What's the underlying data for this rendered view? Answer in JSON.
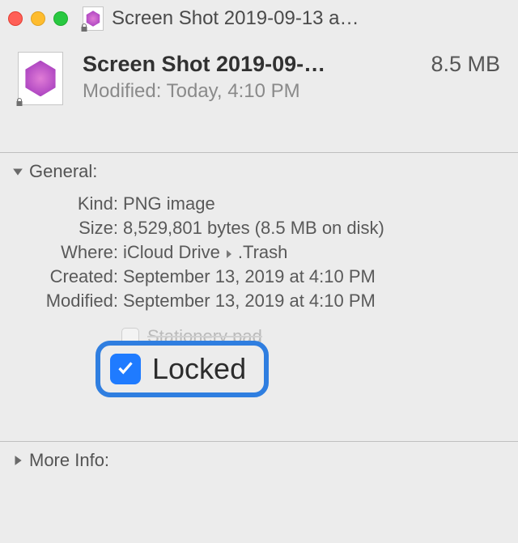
{
  "window": {
    "title": "Screen Shot 2019-09-13 a…"
  },
  "header": {
    "file_name": "Screen Shot 2019-09-…",
    "file_size": "8.5 MB",
    "modified_line": "Modified: Today, 4:10 PM"
  },
  "sections": {
    "general": {
      "title": "General:",
      "kind_label": "Kind:",
      "kind_value": "PNG image",
      "size_label": "Size:",
      "size_value": "8,529,801 bytes (8.5 MB on disk)",
      "where_label": "Where:",
      "where_path": [
        "iCloud Drive",
        ".Trash"
      ],
      "created_label": "Created:",
      "created_value": "September 13, 2019 at 4:10 PM",
      "modified_label": "Modified:",
      "modified_value": "September 13, 2019 at 4:10 PM",
      "stationery_label": "Stationery pad",
      "locked_label": "Locked"
    },
    "more_info": {
      "title": "More Info:"
    }
  }
}
